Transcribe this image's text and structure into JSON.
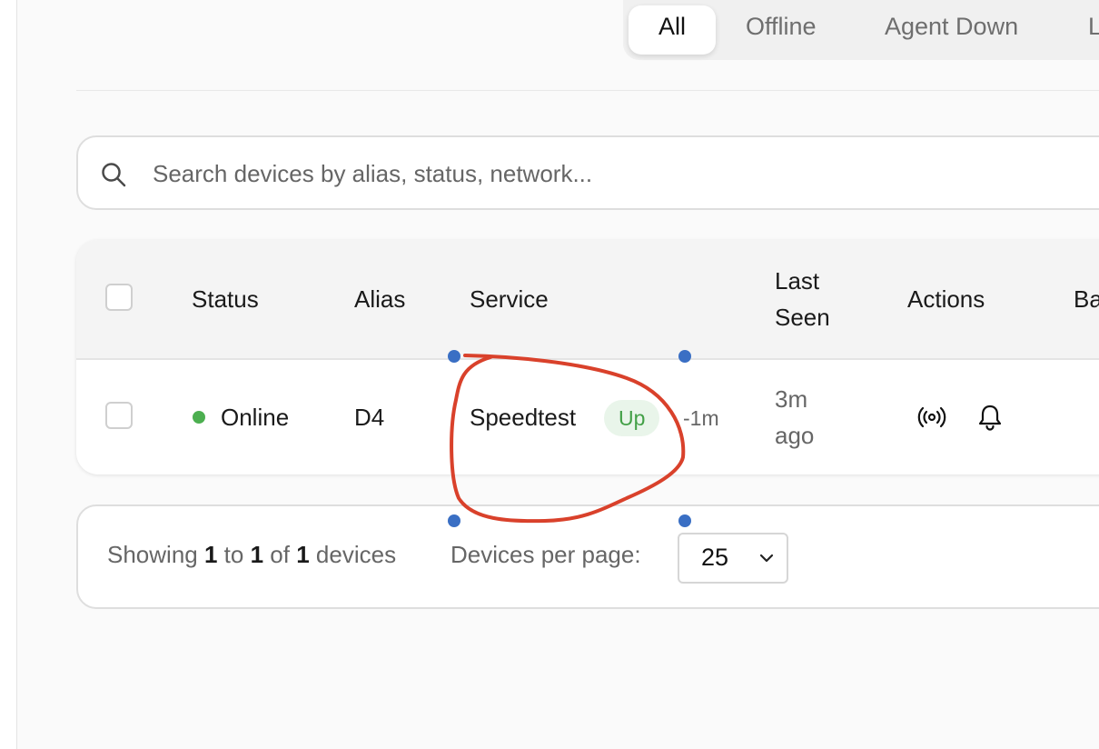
{
  "tabs": {
    "items": [
      {
        "label": "All",
        "active": true
      },
      {
        "label": "Offline",
        "active": false
      },
      {
        "label": "Agent Down",
        "active": false
      },
      {
        "label": "L",
        "active": false
      }
    ]
  },
  "search": {
    "placeholder": "Search devices by alias, status, network...",
    "icon": "search-icon"
  },
  "table": {
    "columns": {
      "status": "Status",
      "alias": "Alias",
      "service": "Service",
      "last_seen_line1": "Last",
      "last_seen_line2": "Seen",
      "actions": "Actions",
      "extra": "Ba"
    },
    "rows": [
      {
        "status": "Online",
        "status_color": "#4caf50",
        "alias": "D4",
        "service": "Speedtest",
        "service_badge": "Up",
        "service_time": "-1m",
        "last_seen_line1": "3m",
        "last_seen_line2": "ago",
        "actions": [
          "broadcast-icon",
          "bell-icon"
        ]
      }
    ]
  },
  "footer": {
    "showing_prefix": "Showing",
    "from": "1",
    "to_word": "to",
    "to": "1",
    "of_word": "of",
    "total": "1",
    "suffix": "devices",
    "per_page_label": "Devices per page:",
    "per_page_value": "25"
  },
  "colors": {
    "accent_online": "#4caf50",
    "badge_bg": "#e9f5ea",
    "annotation_stroke": "#d9412b",
    "annotation_handles": "#3a6fc4"
  }
}
